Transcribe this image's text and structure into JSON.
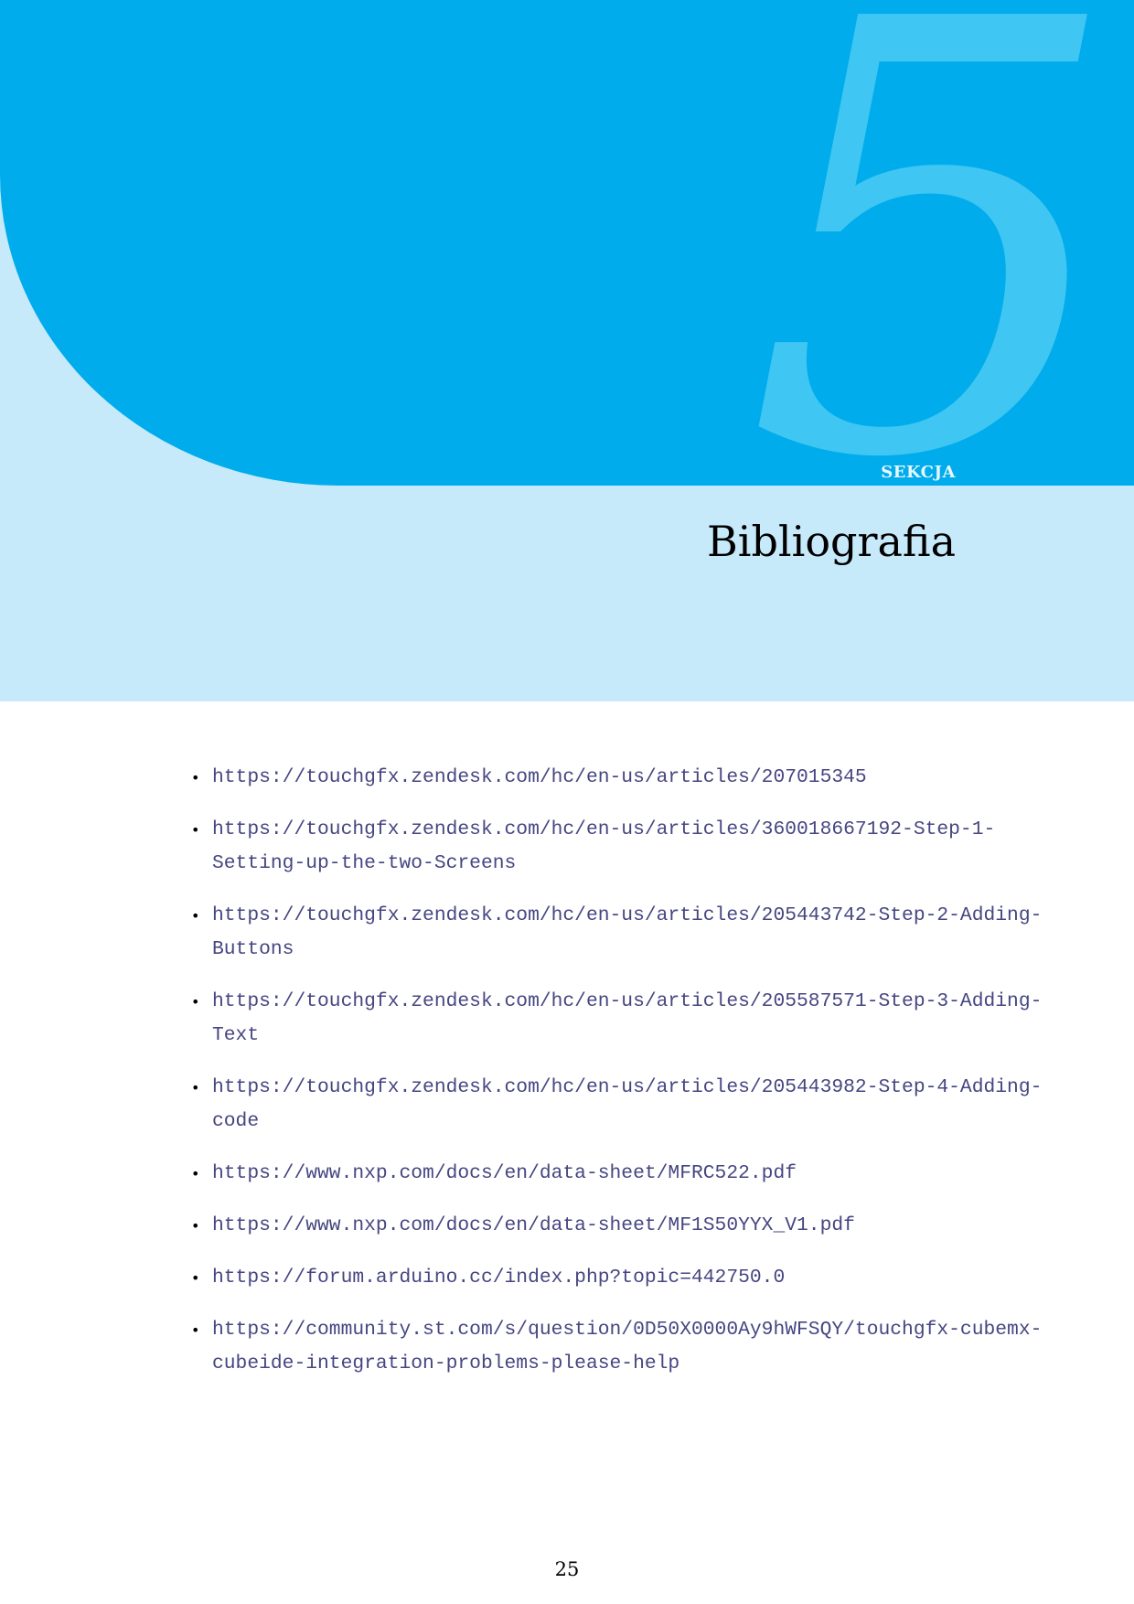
{
  "header": {
    "section_number": "5",
    "section_label": "SEKCJA",
    "title": "Bibliografia",
    "colors": {
      "primary_band": "#00acec",
      "light_band": "#c7eafb",
      "number": "#3fc6f3",
      "link": "#464682"
    }
  },
  "references": [
    {
      "lines": [
        "https://touchgfx.zendesk.com/hc/en-us/articles/207015345"
      ]
    },
    {
      "lines": [
        "https://touchgfx.zendesk.com/hc/en-us/articles/360018667192-Step-1-",
        "Setting-up-the-two-Screens"
      ]
    },
    {
      "lines": [
        "https://touchgfx.zendesk.com/hc/en-us/articles/205443742-Step-2-Adding-",
        "Buttons"
      ]
    },
    {
      "lines": [
        "https://touchgfx.zendesk.com/hc/en-us/articles/205587571-Step-3-Adding-",
        "Text"
      ]
    },
    {
      "lines": [
        "https://touchgfx.zendesk.com/hc/en-us/articles/205443982-Step-4-Adding-",
        "code"
      ]
    },
    {
      "lines": [
        "https://www.nxp.com/docs/en/data-sheet/MFRC522.pdf"
      ]
    },
    {
      "lines": [
        "https://www.nxp.com/docs/en/data-sheet/MF1S50YYX_V1.pdf"
      ]
    },
    {
      "lines": [
        "https://forum.arduino.cc/index.php?topic=442750.0"
      ]
    },
    {
      "lines": [
        "https://community.st.com/s/question/0D50X0000Ay9hWFSQY/touchgfx-cubemx-",
        "cubeide-integration-problems-please-help"
      ]
    }
  ],
  "footer": {
    "page_number": "25"
  }
}
